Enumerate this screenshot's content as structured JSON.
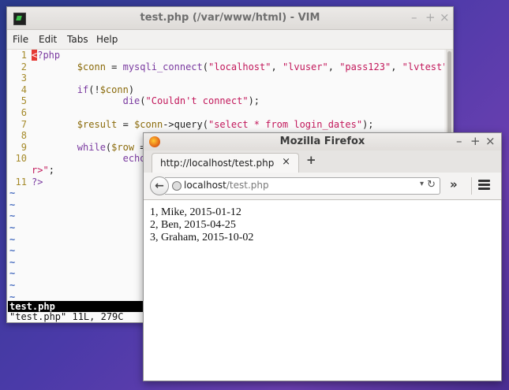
{
  "vim": {
    "title": "test.php (/var/www/html) - VIM",
    "menu": [
      "File",
      "Edit",
      "Tabs",
      "Help"
    ],
    "lines": [
      {
        "n": "1",
        "html": "<span class=\"cursor\">&lt;</span><span class=\"kw\">?php</span>"
      },
      {
        "n": "2",
        "html": "        <span class=\"var\">$conn</span> = <span class=\"fn\">mysqli_connect</span>(<span class=\"str\">\"localhost\"</span>, <span class=\"str\">\"lvuser\"</span>, <span class=\"str\">\"pass123\"</span>, <span class=\"str\">\"lvtest\"</span>);"
      },
      {
        "n": "3",
        "html": ""
      },
      {
        "n": "4",
        "html": "        <span class=\"kw\">if</span>(!<span class=\"var\">$conn</span>)"
      },
      {
        "n": "5",
        "html": "                <span class=\"kw\">die</span>(<span class=\"str\">\"Couldn't connect\"</span>);"
      },
      {
        "n": "6",
        "html": ""
      },
      {
        "n": "7",
        "html": "        <span class=\"var\">$result</span> = <span class=\"var\">$conn</span>-&gt;query(<span class=\"str\">\"select * from login_dates\"</span>);"
      },
      {
        "n": "8",
        "html": ""
      },
      {
        "n": "9",
        "html": "        <span class=\"kw\">while</span>(<span class=\"var\">$row</span> ="
      },
      {
        "n": "10",
        "html": "                <span class=\"kw\">echo</span>"
      },
      {
        "n": "",
        "html": "<span class=\"str\">r&gt;\"</span>;"
      },
      {
        "n": "11",
        "html": "<span class=\"kw\">?&gt;</span>"
      }
    ],
    "tilde_rows": 10,
    "tilde": "~",
    "status": "test.php",
    "cmdline": "\"test.php\" 11L, 279C"
  },
  "firefox": {
    "title": "Mozilla Firefox",
    "tab_label": "http://localhost/test.php",
    "url_host": "localhost",
    "url_path": "/test.php",
    "output": [
      "1, Mike, 2015-01-12",
      "2, Ben, 2015-04-25",
      "3, Graham, 2015-10-02"
    ]
  },
  "window_controls": {
    "minimize": "–",
    "maximize": "+",
    "close": "×"
  },
  "icons": {
    "new_tab": "+",
    "back": "←",
    "dropdown": "▾",
    "reload": "↻",
    "overflow": "»"
  }
}
